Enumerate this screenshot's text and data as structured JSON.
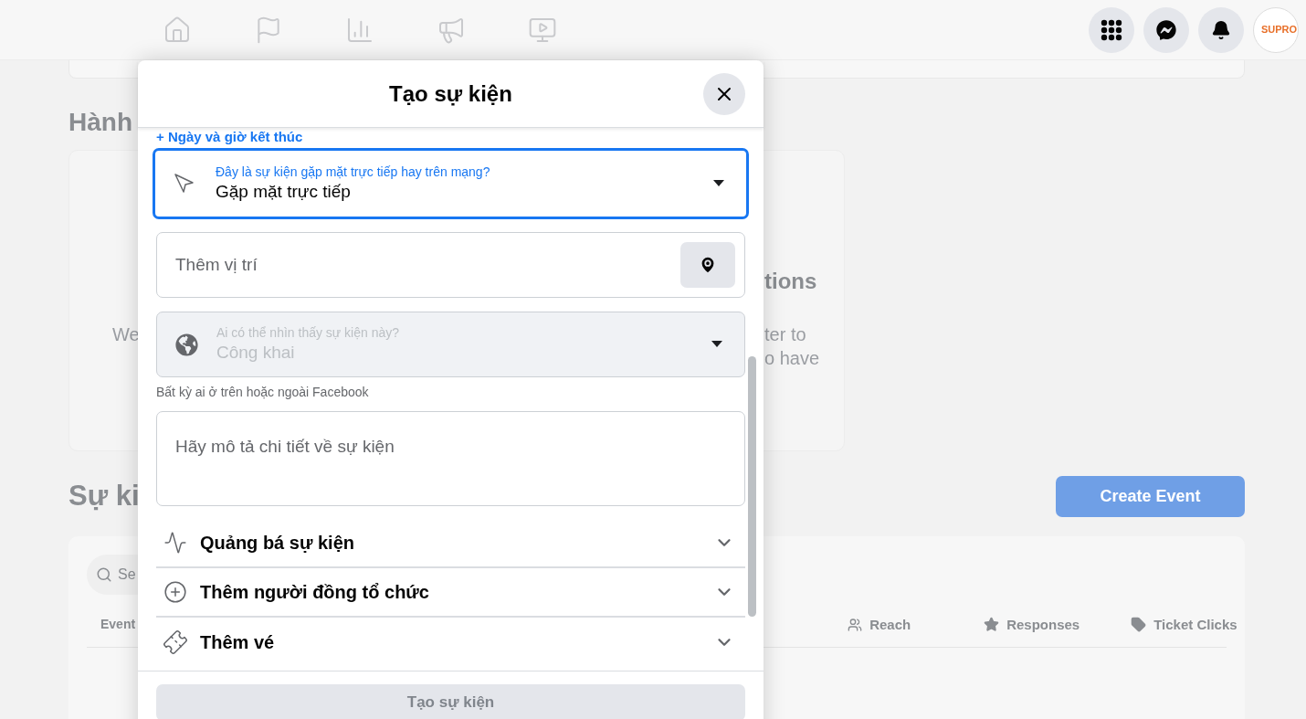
{
  "header": {
    "avatar_text": "SUPRO"
  },
  "background": {
    "section_title": "Hành",
    "card_title": "tions",
    "card_text_left": "We",
    "card_text_right": [
      "ter to",
      "o have"
    ],
    "events_title": "Sự ki",
    "create_button": "Create Event",
    "search_placeholder": "Se",
    "columns": [
      "Event",
      "Reach",
      "Responses",
      "Ticket Clicks"
    ]
  },
  "modal": {
    "title": "Tạo sự kiện",
    "end_date_link": "+ Ngày và giờ kết thúc",
    "event_type": {
      "label": "Đây là sự kiện gặp mặt trực tiếp hay trên mạng?",
      "value": "Gặp mặt trực tiếp",
      "focused": true
    },
    "location": {
      "placeholder": "Thêm vị trí"
    },
    "privacy": {
      "label": "Ai có thể nhìn thấy sự kiện này?",
      "value": "Công khai",
      "disabled": true
    },
    "privacy_hint": "Bất kỳ ai ở trên hoặc ngoài Facebook",
    "description": {
      "placeholder": "Hãy mô tả chi tiết về sự kiện"
    },
    "sections": [
      {
        "kind": "promote",
        "label": "Quảng bá sự kiện",
        "expanded": false
      },
      {
        "kind": "cohost",
        "label": "Thêm người đồng tổ chức",
        "expanded": false
      },
      {
        "kind": "tickets",
        "label": "Thêm vé",
        "expanded": false
      }
    ],
    "submit": {
      "label": "Tạo sự kiện",
      "disabled": true
    }
  }
}
